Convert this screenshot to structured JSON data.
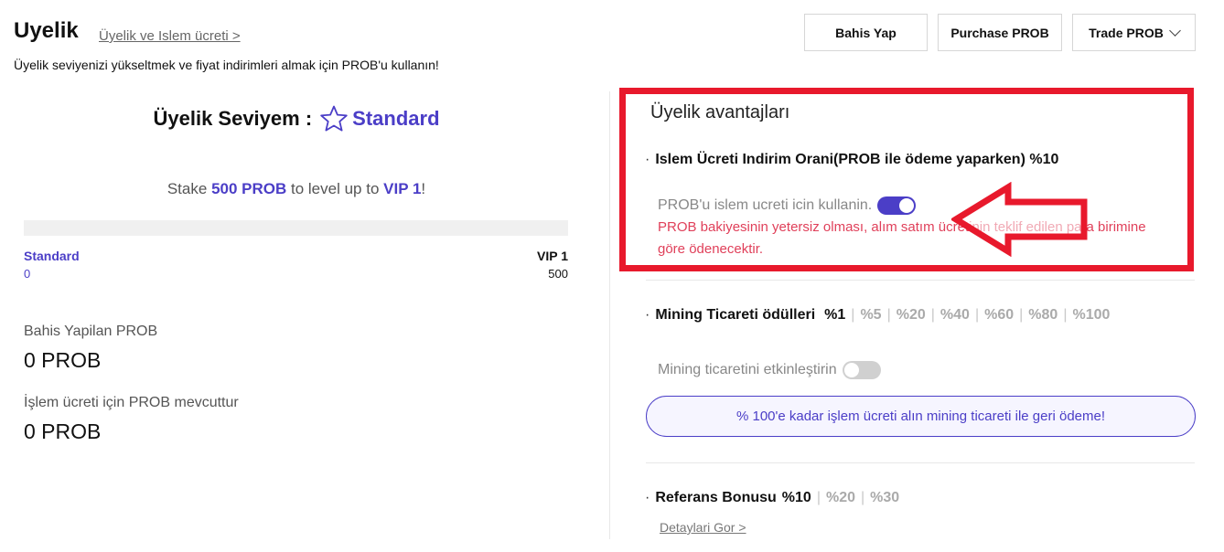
{
  "header": {
    "title": "Uyelik",
    "fee_link": "Üyelik ve Islem ücreti >",
    "subtitle": "Üyelik seviyenizi yükseltmek ve fiyat indirimleri almak için PROB'u kullanın!",
    "buttons": {
      "bet": "Bahis Yap",
      "purchase": "Purchase PROB",
      "trade": "Trade PROB"
    }
  },
  "level": {
    "label": "Üyelik Seviyem :",
    "current": "Standard",
    "icon": "star-outline-icon",
    "stake_prefix": "Stake",
    "stake_amount": "500 PROB",
    "stake_middle": "to level up to",
    "stake_target": "VIP 1",
    "stake_suffix": "!",
    "progress": {
      "fraction": 0,
      "from_label": "Standard",
      "from_value": "0",
      "to_label": "VIP 1",
      "to_value": "500"
    }
  },
  "stats": [
    {
      "label": "Bahis Yapilan PROB",
      "value": "0 PROB"
    },
    {
      "label": "İşlem ücreti için PROB mevcuttur",
      "value": "0 PROB"
    }
  ],
  "advantages": {
    "title": "Üyelik avantajları",
    "fee_discount": {
      "dot": "·",
      "label": "Islem Ücreti Indirim Orani(PROB ile ödeme yaparken) %10",
      "option_label": "PROB'u islem ucreti icin kullanin.",
      "toggle_on": true,
      "warning": "PROB bakiyesinin yetersiz olması, alım satım ücretinin teklif edilen para birimine göre ödenecektir."
    },
    "mining": {
      "dot": "·",
      "label": "Mining Ticareti ödülleri",
      "active_tier": "%1",
      "tiers": [
        "%5",
        "%20",
        "%40",
        "%60",
        "%80",
        "%100"
      ],
      "separator": "|",
      "option_label": "Mining ticaretini etkinleştirin",
      "toggle_on": false,
      "promo": "% 100'e kadar işlem ücreti alın mining ticareti ile geri ödeme!"
    },
    "referral": {
      "dot": "·",
      "label": "Referans Bonusu",
      "active_tier": "%10",
      "tiers": [
        "%20",
        "%30"
      ],
      "separator": "|",
      "details_link": "Detaylari Gor >"
    }
  },
  "colors": {
    "accent": "#4b3ec7",
    "highlight": "#e8192c",
    "warning": "#e0405a"
  }
}
